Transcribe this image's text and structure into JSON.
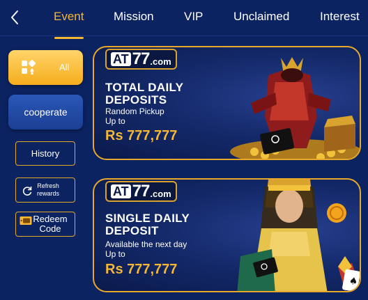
{
  "nav": {
    "back_icon": "chevron-left-icon",
    "tabs": [
      {
        "label": "Event",
        "active": true
      },
      {
        "label": "Mission",
        "active": false
      },
      {
        "label": "VIP",
        "active": false
      },
      {
        "label": "Unclaimed",
        "active": false
      },
      {
        "label": "Interest",
        "active": false
      }
    ]
  },
  "sidebar": {
    "all_label": "All",
    "cooperate_label": "cooperate",
    "history_label": "History",
    "refresh_label_1": "Refresh",
    "refresh_label_2": "rewards",
    "redeem_label_1": "Redeem",
    "redeem_label_2": "Code"
  },
  "banners": [
    {
      "logo_at": "AT",
      "logo_num": "77",
      "logo_domain": ".com",
      "title_1": "TOTAL DAILY",
      "title_2": "DEPOSITS",
      "sub_1": "Random Pickup",
      "sub_2": "Up to",
      "amount": "Rs 777,777"
    },
    {
      "logo_at": "AT",
      "logo_num": "77",
      "logo_domain": ".com",
      "title_1": "SINGLE DAILY",
      "title_2": "DEPOSIT",
      "sub_1": "Available the next day",
      "sub_2": "Up to",
      "amount": "Rs 777,777"
    }
  ],
  "colors": {
    "background": "#0c2361",
    "accent": "#f7b733",
    "banner_border": "#e8a92b"
  }
}
